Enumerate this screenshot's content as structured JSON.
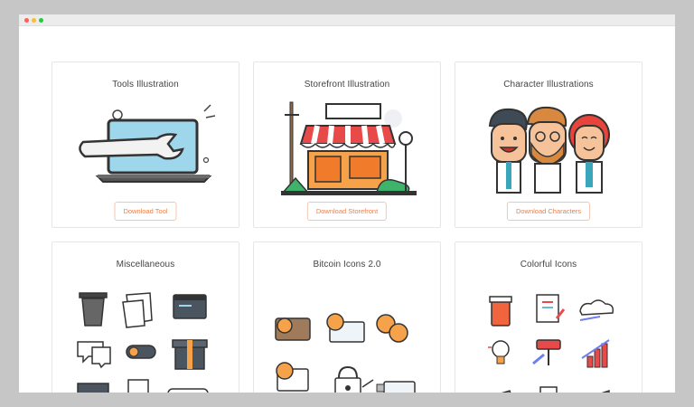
{
  "window": {
    "controls": [
      "close",
      "minimize",
      "maximize"
    ]
  },
  "cards": [
    {
      "title": "Tools Illustration",
      "button": "Download Tool"
    },
    {
      "title": "Storefront Illustration",
      "button": "Download Storefront"
    },
    {
      "title": "Character Illustrations",
      "button": "Download Characters"
    },
    {
      "title": "Miscellaneous"
    },
    {
      "title": "Bitcoin Icons 2.0"
    },
    {
      "title": "Colorful Icons"
    }
  ],
  "colors": {
    "accent": "#ee7d45",
    "border": "#e6e6e6",
    "chrome": "#c6c6c6"
  },
  "icons": [
    "wrench-laptop-illustration",
    "storefront-illustration",
    "characters-illustration",
    "misc-icons",
    "bitcoin-icons",
    "colorful-icons"
  ]
}
